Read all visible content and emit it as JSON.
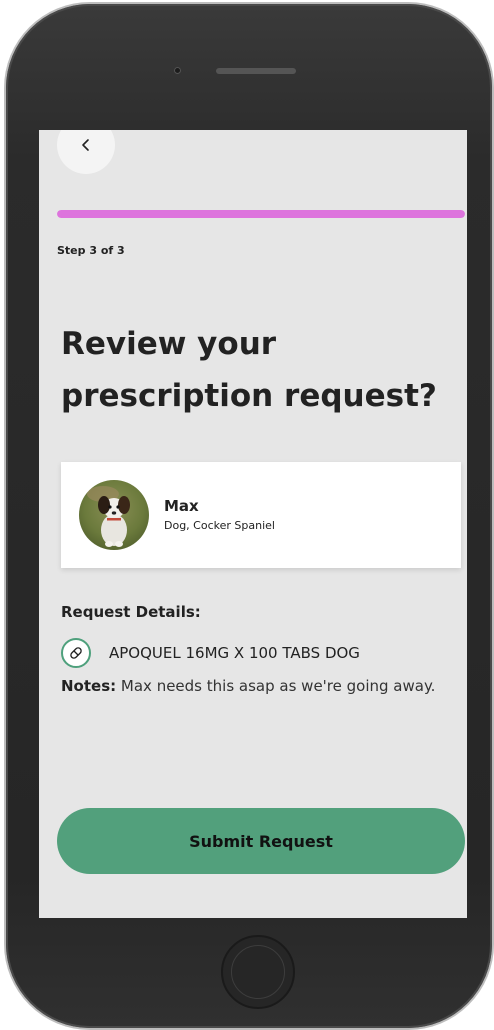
{
  "nav": {
    "back_icon": "chevron-left-icon"
  },
  "progress": {
    "current_step": 3,
    "total_steps": 3,
    "fraction": 1.0,
    "color": "#dd74dd",
    "label": "Step 3 of 3"
  },
  "title": "Review your prescription request?",
  "pet": {
    "name": "Max",
    "breed": "Dog, Cocker Spaniel"
  },
  "request_details": {
    "heading": "Request Details:",
    "medication_icon": "pill-icon",
    "medication": "APOQUEL 16MG X 100 TABS DOG",
    "notes_label": "Notes:",
    "notes_text": "Max needs this asap as we're going away."
  },
  "submit": {
    "label": "Submit Request",
    "color": "#52a07c"
  }
}
